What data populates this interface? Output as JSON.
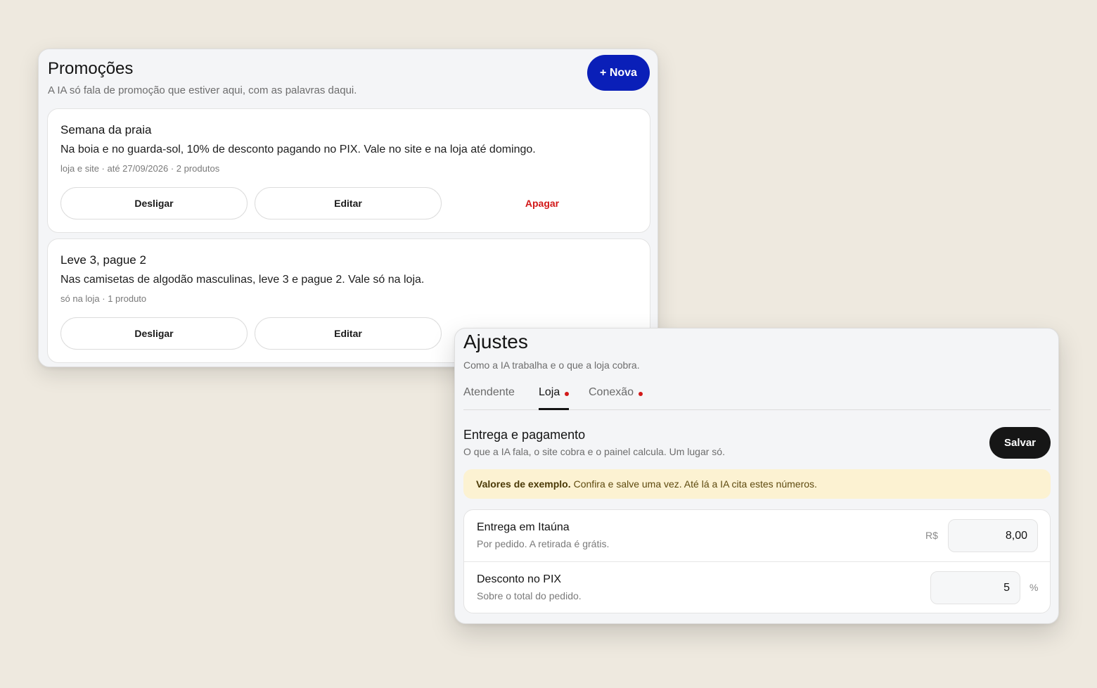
{
  "promotions": {
    "title": "Promoções",
    "subtitle": "A IA só fala de promoção que estiver aqui, com as palavras daqui.",
    "new_button": "+ Nova",
    "items": [
      {
        "name": "Semana da praia",
        "description": "Na boia e no guarda-sol, 10% de desconto pagando no PIX. Vale no site e na loja até domingo.",
        "meta": "loja e site · até 27/09/2026 · 2 produtos",
        "actions": {
          "toggle": "Desligar",
          "edit": "Editar",
          "delete": "Apagar"
        }
      },
      {
        "name": "Leve 3, pague 2",
        "description": "Nas camisetas de algodão masculinas, leve 3 e pague 2. Vale só na loja.",
        "meta": "só na loja · 1 produto",
        "actions": {
          "toggle": "Desligar",
          "edit": "Editar"
        }
      }
    ]
  },
  "settings": {
    "title": "Ajustes",
    "subtitle": "Como a IA trabalha e o que a loja cobra.",
    "tabs": [
      {
        "label": "Atendente",
        "active": false,
        "has_dot": false
      },
      {
        "label": "Loja",
        "active": true,
        "has_dot": true
      },
      {
        "label": "Conexão",
        "active": false,
        "has_dot": true
      }
    ],
    "section": {
      "title": "Entrega e pagamento",
      "subtitle": "O que a IA fala, o site cobra e o painel calcula. Um lugar só.",
      "save_button": "Salvar"
    },
    "notice": {
      "bold": "Valores de exemplo.",
      "text": "Confira e salve uma vez. Até lá a IA cita estes números."
    },
    "fields": [
      {
        "label": "Entrega em Itaúna",
        "help": "Por pedido. A retirada é grátis.",
        "prefix": "R$",
        "value": "8,00"
      },
      {
        "label": "Desconto no PIX",
        "help": "Sobre o total do pedido.",
        "suffix": "%",
        "value": "5"
      }
    ]
  },
  "colors": {
    "background": "#eee9df",
    "primary": "#0a1fb8",
    "danger": "#d21919",
    "dark_button": "#161616",
    "notice_bg": "#fcf2d2"
  }
}
